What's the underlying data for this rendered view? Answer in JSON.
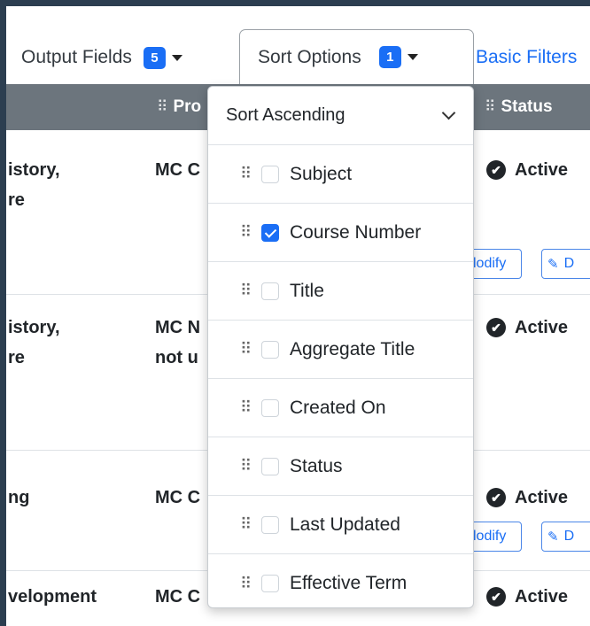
{
  "toolbar": {
    "output_fields_label": "Output Fields",
    "output_fields_count": "5",
    "sort_options_label": "Sort Options",
    "sort_options_count": "1",
    "basic_filters_label": "Basic Filters"
  },
  "table": {
    "headers": {
      "program": "Pro",
      "status": "Status"
    },
    "rows": [
      {
        "name_line1": "istory,",
        "name_line2": "re",
        "program_line1": "MC C",
        "program_line2": "",
        "status": "Active",
        "modify": "lodify",
        "delete": "D"
      },
      {
        "name_line1": "istory,",
        "name_line2": "re",
        "program_line1": "MC N",
        "program_line2": "not u",
        "status": "Active",
        "modify": "",
        "delete": ""
      },
      {
        "name_line1": "ng",
        "name_line2": "",
        "program_line1": "MC C",
        "program_line2": "",
        "status": "Active",
        "modify": "lodify",
        "delete": "D"
      },
      {
        "name_line1": "velopment",
        "name_line2": "",
        "program_line1": "MC C",
        "program_line2": "",
        "status": "Active",
        "modify": "",
        "delete": ""
      }
    ]
  },
  "sort_menu": {
    "direction": "Sort Ascending",
    "options": [
      {
        "label": "Subject",
        "checked": false
      },
      {
        "label": "Course Number",
        "checked": true
      },
      {
        "label": "Title",
        "checked": false
      },
      {
        "label": "Aggregate Title",
        "checked": false
      },
      {
        "label": "Created On",
        "checked": false
      },
      {
        "label": "Status",
        "checked": false
      },
      {
        "label": "Last Updated",
        "checked": false
      },
      {
        "label": "Effective Term",
        "checked": false
      }
    ]
  },
  "colors": {
    "accent": "#1a6ef5",
    "header_bg": "#6c757d",
    "frame": "#2c3e50"
  },
  "icons": {
    "grip": "drag-handle-icon",
    "caret": "caret-down-icon",
    "check": "check-circle-icon",
    "edit": "pencil-square-icon"
  }
}
